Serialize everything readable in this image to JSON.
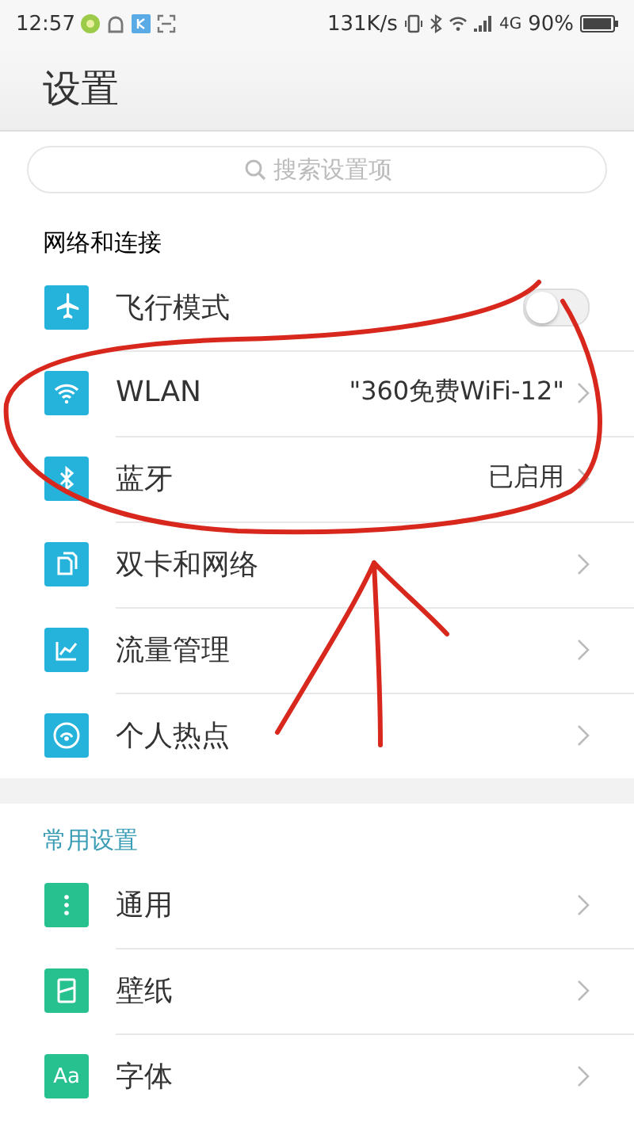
{
  "status_bar": {
    "time": "12:57",
    "speed": "131K/s",
    "network": "4G",
    "battery": "90%"
  },
  "title": "设置",
  "search": {
    "placeholder": "搜索设置项"
  },
  "sections": [
    {
      "header": "网络和连接",
      "color": "#25b3dc",
      "items": [
        {
          "label": "飞行模式",
          "kind": "toggle",
          "on": false
        },
        {
          "label": "WLAN",
          "kind": "link",
          "value": "\"360免费WiFi-12\""
        },
        {
          "label": "蓝牙",
          "kind": "link",
          "value": "已启用"
        },
        {
          "label": "双卡和网络",
          "kind": "link"
        },
        {
          "label": "流量管理",
          "kind": "link"
        },
        {
          "label": "个人热点",
          "kind": "link"
        }
      ]
    },
    {
      "header": "常用设置",
      "color": "#27c08f",
      "items": [
        {
          "label": "通用",
          "kind": "link"
        },
        {
          "label": "壁纸",
          "kind": "link"
        },
        {
          "label": "字体",
          "kind": "link",
          "icon_text": "Aa"
        }
      ]
    }
  ]
}
